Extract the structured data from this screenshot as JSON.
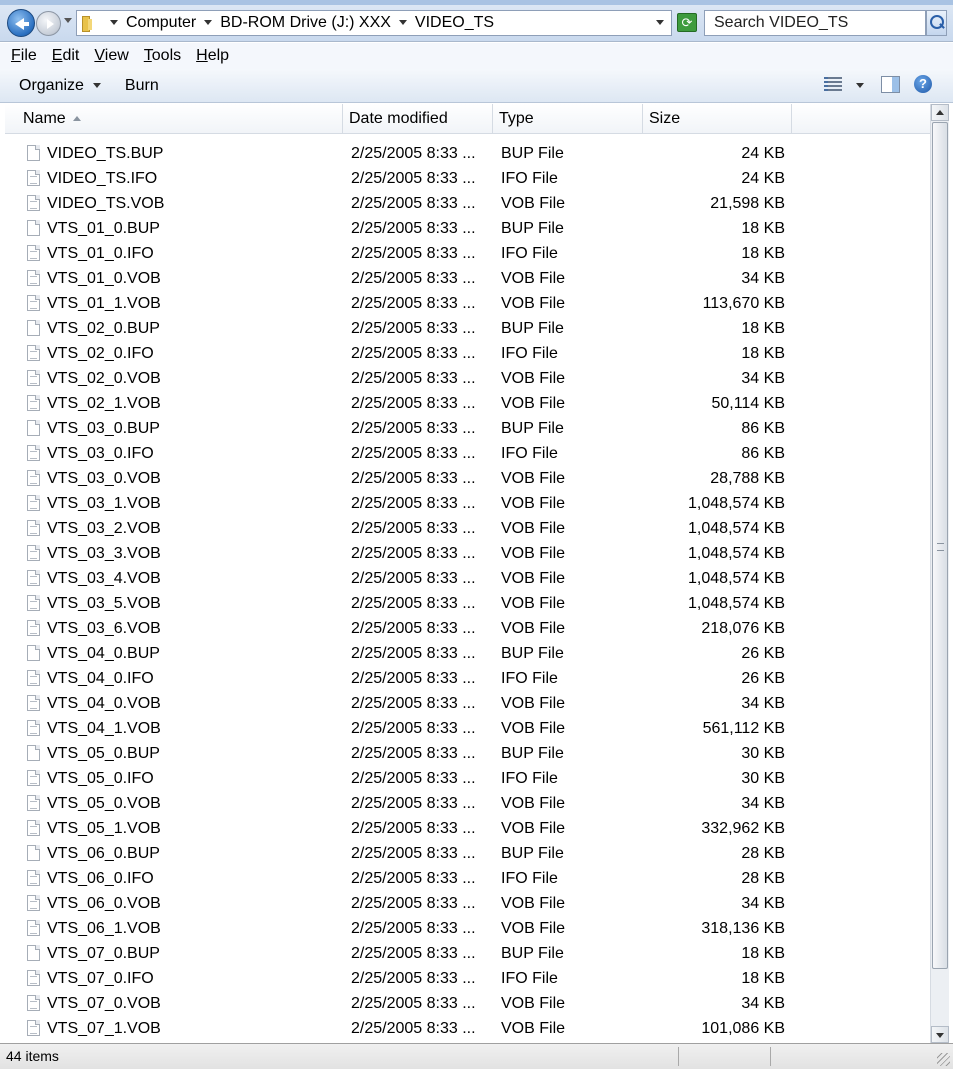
{
  "address": {
    "crumbs": [
      "Computer",
      "BD-ROM Drive (J:) XXX",
      "VIDEO_TS"
    ]
  },
  "search": {
    "placeholder": "Search VIDEO_TS"
  },
  "menu": {
    "file": {
      "ul": "F",
      "rest": "ile"
    },
    "edit": {
      "ul": "E",
      "rest": "dit"
    },
    "view": {
      "ul": "V",
      "rest": "iew"
    },
    "tools": {
      "ul": "T",
      "rest": "ools"
    },
    "help": {
      "ul": "H",
      "rest": "elp"
    }
  },
  "toolbar": {
    "organize": "Organize",
    "burn": "Burn"
  },
  "columns": {
    "name": "Name",
    "date": "Date modified",
    "type": "Type",
    "size": "Size"
  },
  "files": [
    {
      "name": "VIDEO_TS.BUP",
      "date": "2/25/2005 8:33 ...",
      "type": "BUP File",
      "size": "24 KB"
    },
    {
      "name": "VIDEO_TS.IFO",
      "date": "2/25/2005 8:33 ...",
      "type": "IFO File",
      "size": "24 KB"
    },
    {
      "name": "VIDEO_TS.VOB",
      "date": "2/25/2005 8:33 ...",
      "type": "VOB File",
      "size": "21,598 KB"
    },
    {
      "name": "VTS_01_0.BUP",
      "date": "2/25/2005 8:33 ...",
      "type": "BUP File",
      "size": "18 KB"
    },
    {
      "name": "VTS_01_0.IFO",
      "date": "2/25/2005 8:33 ...",
      "type": "IFO File",
      "size": "18 KB"
    },
    {
      "name": "VTS_01_0.VOB",
      "date": "2/25/2005 8:33 ...",
      "type": "VOB File",
      "size": "34 KB"
    },
    {
      "name": "VTS_01_1.VOB",
      "date": "2/25/2005 8:33 ...",
      "type": "VOB File",
      "size": "113,670 KB"
    },
    {
      "name": "VTS_02_0.BUP",
      "date": "2/25/2005 8:33 ...",
      "type": "BUP File",
      "size": "18 KB"
    },
    {
      "name": "VTS_02_0.IFO",
      "date": "2/25/2005 8:33 ...",
      "type": "IFO File",
      "size": "18 KB"
    },
    {
      "name": "VTS_02_0.VOB",
      "date": "2/25/2005 8:33 ...",
      "type": "VOB File",
      "size": "34 KB"
    },
    {
      "name": "VTS_02_1.VOB",
      "date": "2/25/2005 8:33 ...",
      "type": "VOB File",
      "size": "50,114 KB"
    },
    {
      "name": "VTS_03_0.BUP",
      "date": "2/25/2005 8:33 ...",
      "type": "BUP File",
      "size": "86 KB"
    },
    {
      "name": "VTS_03_0.IFO",
      "date": "2/25/2005 8:33 ...",
      "type": "IFO File",
      "size": "86 KB"
    },
    {
      "name": "VTS_03_0.VOB",
      "date": "2/25/2005 8:33 ...",
      "type": "VOB File",
      "size": "28,788 KB"
    },
    {
      "name": "VTS_03_1.VOB",
      "date": "2/25/2005 8:33 ...",
      "type": "VOB File",
      "size": "1,048,574 KB"
    },
    {
      "name": "VTS_03_2.VOB",
      "date": "2/25/2005 8:33 ...",
      "type": "VOB File",
      "size": "1,048,574 KB"
    },
    {
      "name": "VTS_03_3.VOB",
      "date": "2/25/2005 8:33 ...",
      "type": "VOB File",
      "size": "1,048,574 KB"
    },
    {
      "name": "VTS_03_4.VOB",
      "date": "2/25/2005 8:33 ...",
      "type": "VOB File",
      "size": "1,048,574 KB"
    },
    {
      "name": "VTS_03_5.VOB",
      "date": "2/25/2005 8:33 ...",
      "type": "VOB File",
      "size": "1,048,574 KB"
    },
    {
      "name": "VTS_03_6.VOB",
      "date": "2/25/2005 8:33 ...",
      "type": "VOB File",
      "size": "218,076 KB"
    },
    {
      "name": "VTS_04_0.BUP",
      "date": "2/25/2005 8:33 ...",
      "type": "BUP File",
      "size": "26 KB"
    },
    {
      "name": "VTS_04_0.IFO",
      "date": "2/25/2005 8:33 ...",
      "type": "IFO File",
      "size": "26 KB"
    },
    {
      "name": "VTS_04_0.VOB",
      "date": "2/25/2005 8:33 ...",
      "type": "VOB File",
      "size": "34 KB"
    },
    {
      "name": "VTS_04_1.VOB",
      "date": "2/25/2005 8:33 ...",
      "type": "VOB File",
      "size": "561,112 KB"
    },
    {
      "name": "VTS_05_0.BUP",
      "date": "2/25/2005 8:33 ...",
      "type": "BUP File",
      "size": "30 KB"
    },
    {
      "name": "VTS_05_0.IFO",
      "date": "2/25/2005 8:33 ...",
      "type": "IFO File",
      "size": "30 KB"
    },
    {
      "name": "VTS_05_0.VOB",
      "date": "2/25/2005 8:33 ...",
      "type": "VOB File",
      "size": "34 KB"
    },
    {
      "name": "VTS_05_1.VOB",
      "date": "2/25/2005 8:33 ...",
      "type": "VOB File",
      "size": "332,962 KB"
    },
    {
      "name": "VTS_06_0.BUP",
      "date": "2/25/2005 8:33 ...",
      "type": "BUP File",
      "size": "28 KB"
    },
    {
      "name": "VTS_06_0.IFO",
      "date": "2/25/2005 8:33 ...",
      "type": "IFO File",
      "size": "28 KB"
    },
    {
      "name": "VTS_06_0.VOB",
      "date": "2/25/2005 8:33 ...",
      "type": "VOB File",
      "size": "34 KB"
    },
    {
      "name": "VTS_06_1.VOB",
      "date": "2/25/2005 8:33 ...",
      "type": "VOB File",
      "size": "318,136 KB"
    },
    {
      "name": "VTS_07_0.BUP",
      "date": "2/25/2005 8:33 ...",
      "type": "BUP File",
      "size": "18 KB"
    },
    {
      "name": "VTS_07_0.IFO",
      "date": "2/25/2005 8:33 ...",
      "type": "IFO File",
      "size": "18 KB"
    },
    {
      "name": "VTS_07_0.VOB",
      "date": "2/25/2005 8:33 ...",
      "type": "VOB File",
      "size": "34 KB"
    },
    {
      "name": "VTS_07_1.VOB",
      "date": "2/25/2005 8:33 ...",
      "type": "VOB File",
      "size": "101,086 KB"
    }
  ],
  "status": {
    "item_count": "44 items"
  },
  "icons": {
    "back": "back-arrow-icon",
    "forward": "forward-arrow-icon",
    "folder": "folder-icon",
    "refresh": "refresh-icon",
    "search": "search-icon",
    "views": "views-icon",
    "preview": "preview-pane-icon",
    "help": "help-icon",
    "file": "file-icon"
  }
}
